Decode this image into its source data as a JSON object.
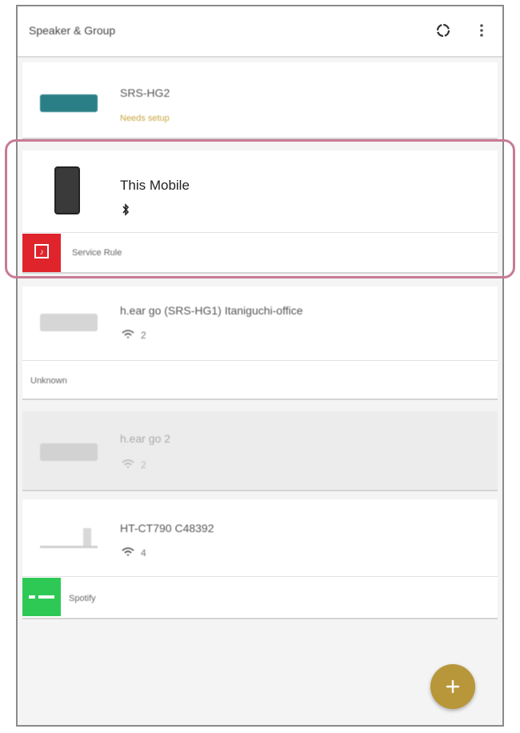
{
  "appbar": {
    "title": "Speaker & Group",
    "refresh_icon": "refresh-icon",
    "menu_icon": "more-vert-icon"
  },
  "devices": [
    {
      "name": "SRS-HG2",
      "status": "Needs setup"
    },
    {
      "name": "This Mobile",
      "connection_icon": "bluetooth-icon",
      "source": "Service Rule"
    },
    {
      "name": "h.ear go (SRS-HG1) Itaniguchi-office",
      "connection_icon": "wifi-icon",
      "count": "2",
      "source": "Unknown"
    },
    {
      "name": "h.ear go 2",
      "connection_icon": "wifi-icon",
      "count": "2"
    },
    {
      "name": "HT-CT790 C48392",
      "connection_icon": "wifi-icon",
      "count": "4",
      "source": "Spotify"
    }
  ],
  "fab": {
    "icon": "plus-icon"
  },
  "colors": {
    "accent": "#b8963a",
    "highlight": "#c87a95",
    "spotify": "#2ec955",
    "service": "#e0242c"
  }
}
